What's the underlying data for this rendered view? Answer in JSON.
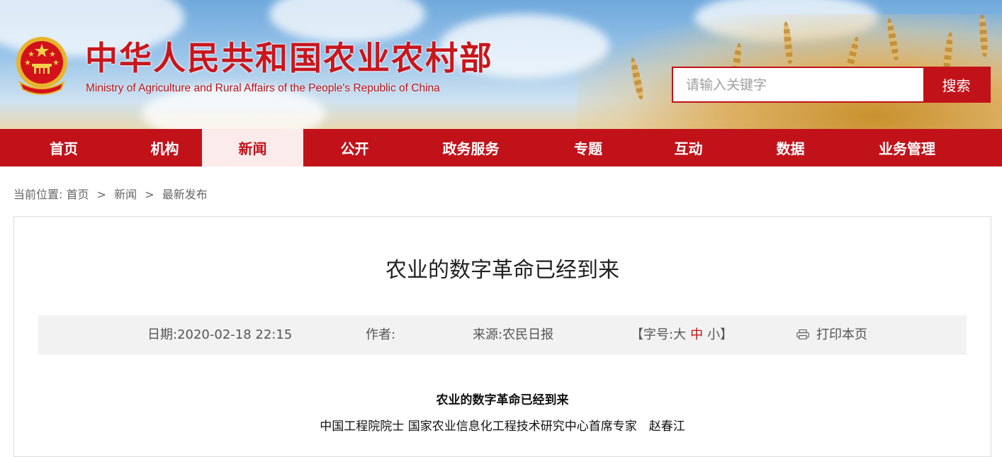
{
  "header": {
    "title": "中华人民共和国农业农村部",
    "subtitle": "Ministry of Agriculture and Rural Affairs of the People's Republic of China",
    "emblem_icon": "national-emblem-icon"
  },
  "search": {
    "placeholder": "请输入关键字",
    "button_label": "搜索"
  },
  "nav": {
    "items": [
      {
        "label": "首页"
      },
      {
        "label": "机构"
      },
      {
        "label": "新闻",
        "active": true
      },
      {
        "label": "公开"
      },
      {
        "label": "政务服务"
      },
      {
        "label": "专题"
      },
      {
        "label": "互动"
      },
      {
        "label": "数据"
      },
      {
        "label": "业务管理"
      }
    ]
  },
  "breadcrumb": {
    "prefix": "当前位置:",
    "items": [
      "首页",
      "新闻",
      "最新发布"
    ],
    "separator": ">"
  },
  "article": {
    "title": "农业的数字革命已经到来",
    "meta": {
      "date_label": "日期:",
      "date_value": "2020-02-18 22:15",
      "author_label": "作者:",
      "author_value": "",
      "source_label": "来源:",
      "source_value": "农民日报",
      "fontsize_open": "【字号:",
      "fontsize_large": "大",
      "fontsize_medium": "中",
      "fontsize_small": "小",
      "fontsize_close": "】",
      "print_label": "打印本页",
      "print_icon": "printer-icon"
    },
    "body_title": "农业的数字革命已经到来",
    "body_author": "中国工程院院士 国家农业信息化工程技术研究中心首席专家　赵春江"
  },
  "colors": {
    "brand_red": "#c1121a",
    "nav_active_bg": "#fcebeb",
    "meta_bg": "#f2f2f2"
  }
}
